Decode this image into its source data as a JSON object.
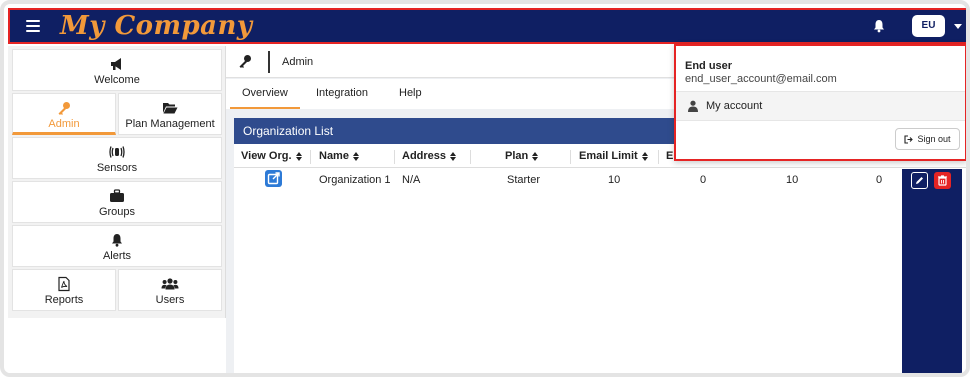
{
  "app": {
    "brand": "My Company"
  },
  "topbar": {
    "user_initials": "EU"
  },
  "sidebar": {
    "items": [
      {
        "label": "Welcome",
        "icon": "megaphone-icon"
      },
      {
        "label": "Admin",
        "icon": "key-icon",
        "active": true
      },
      {
        "label": "Plan Management",
        "icon": "folder-open-icon"
      },
      {
        "label": "Sensors",
        "icon": "sensor-icon"
      },
      {
        "label": "Groups",
        "icon": "briefcase-icon"
      },
      {
        "label": "Alerts",
        "icon": "bell-icon"
      },
      {
        "label": "Reports",
        "icon": "pdf-file-icon"
      },
      {
        "label": "Users",
        "icon": "users-icon"
      }
    ]
  },
  "breadcrumb": {
    "label": "Admin"
  },
  "tabs": [
    {
      "label": "Overview",
      "active": true
    },
    {
      "label": "Integration"
    },
    {
      "label": "Help"
    }
  ],
  "panel": {
    "title": "Organization List"
  },
  "table": {
    "headers": [
      "View Org.",
      "Name",
      "Address",
      "Plan",
      "Email Limit",
      "E"
    ],
    "rows": [
      {
        "name": "Organization 1",
        "address": "N/A",
        "plan": "Starter",
        "email_limit": "10",
        "c6": "0",
        "c7": "10",
        "c8": "0"
      }
    ]
  },
  "dropdown": {
    "user_name": "End user",
    "user_email": "end_user_account@email.com",
    "my_account": "My account",
    "sign_out": "Sign out"
  },
  "colors": {
    "navy": "#0f1f63",
    "accent": "#f2993a",
    "panel_header": "#2f4b8d",
    "danger": "#e52424",
    "highlight_border": "#e52424"
  }
}
